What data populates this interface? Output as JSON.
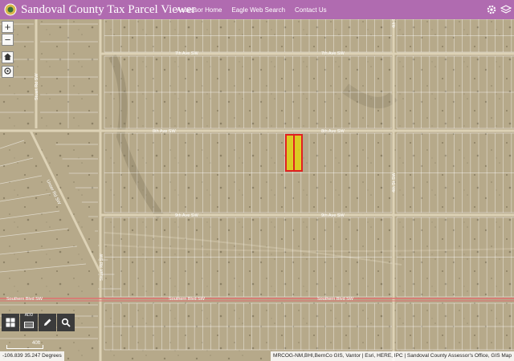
{
  "header": {
    "title": "Sandoval County Tax Parcel Viewer",
    "nav": [
      "Assessor Home",
      "Eagle Web Search",
      "Contact Us"
    ]
  },
  "map_controls": {
    "zoom_in": "+",
    "zoom_out": "−"
  },
  "toolbar": {
    "tool_2_label": "ADD"
  },
  "roads": {
    "seventh_ave": "7th Ave SW",
    "eighth_ave": "8th Ave SW",
    "ninth_ave": "9th Ave SW",
    "southern_blvd": "Southern Blvd SW",
    "left_vertical": "Stuart Rd SW",
    "diagonal": "Unser Rd SW",
    "right_vertical": "4th St SW"
  },
  "scale": {
    "label": "40ft"
  },
  "status": {
    "coordinates": "-106.839 35.247 Degrees",
    "attribution": "MRCOG-NM,BHI,BernCo GIS, Vantor | Esri, HERE, IPC | Sandoval County Assessor's Office, GIS Map"
  },
  "colors": {
    "header_bg": "#b06bb0",
    "terrain": "#b6a98a",
    "selection_outline": "#e02020",
    "selection_fill": "#e8d400"
  }
}
